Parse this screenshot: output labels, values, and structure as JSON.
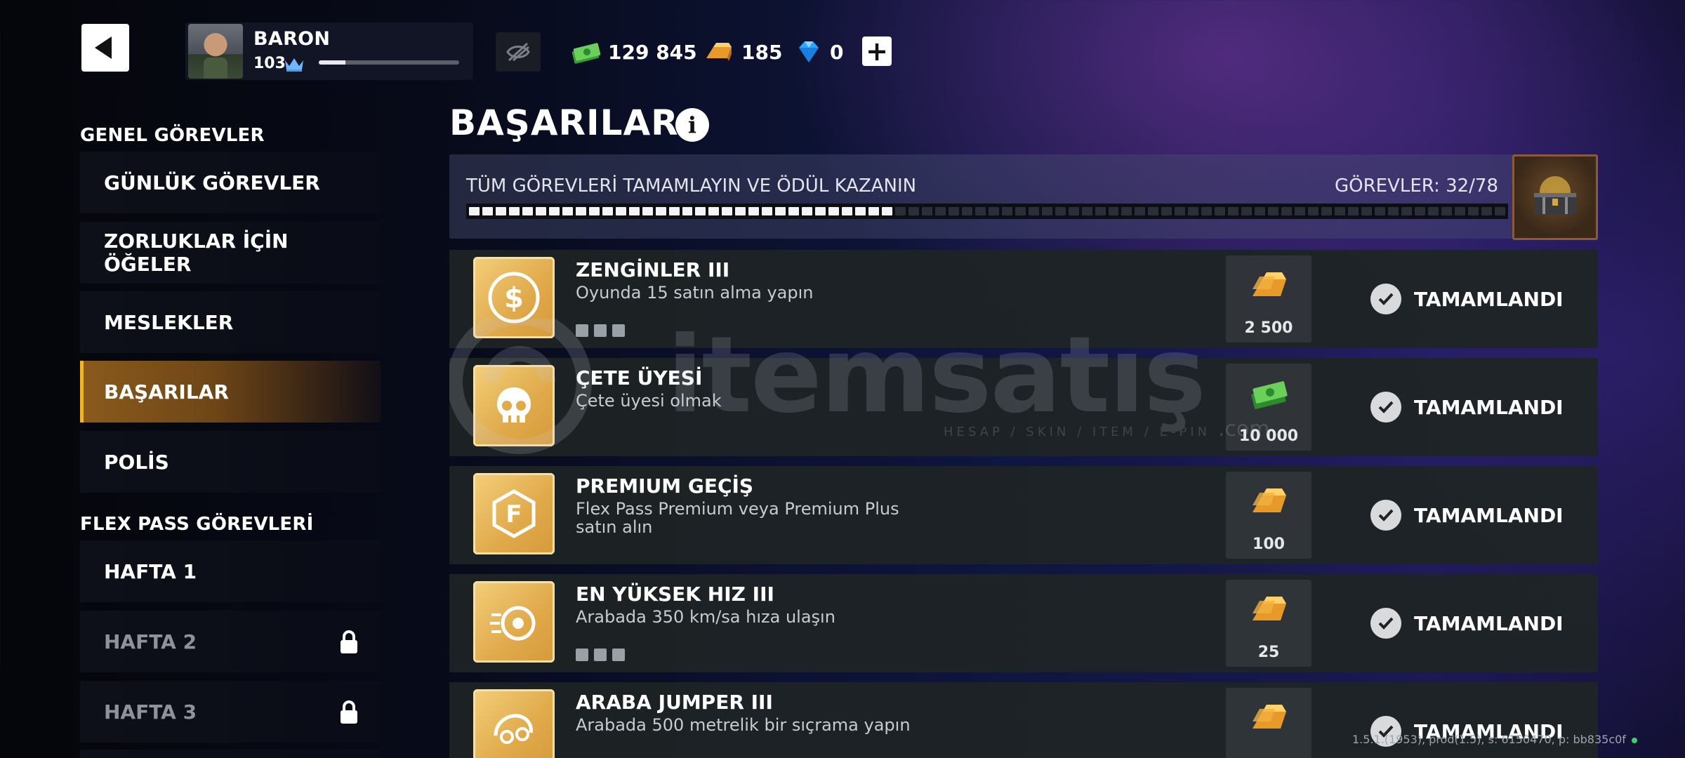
{
  "player": {
    "name": "BARON",
    "level": "103",
    "xp_fraction": 0.19
  },
  "currencies": {
    "cash": "129 845",
    "gold": "185",
    "gems": "0",
    "plus_label": "+"
  },
  "sidebar": {
    "section1": "GENEL GÖREVLER",
    "items1": [
      {
        "label": "GÜNLÜK GÖREVLER"
      },
      {
        "label": "ZORLUKLAR İÇİN ÖĞELER"
      },
      {
        "label": "MESLEKLER"
      },
      {
        "label": "BAŞARILAR"
      },
      {
        "label": "POLİS"
      }
    ],
    "section2": "FLEX PASS GÖREVLERİ",
    "items2": [
      {
        "label": "HAFTA 1"
      },
      {
        "label": "HAFTA 2"
      },
      {
        "label": "HAFTA 3"
      }
    ]
  },
  "main": {
    "title": "BAŞARILAR",
    "info_glyph": "i",
    "progress_title": "TÜM GÖREVLERİ TAMAMLAYIN VE ÖDÜL KAZANIN",
    "progress_count": "GÖREVLER: 32/78",
    "completed": 32,
    "total": 78
  },
  "achievements": [
    {
      "name": "ZENGİNLER III",
      "desc": "Oyunda 15 satın alma yapın",
      "reward": "2 500",
      "reward_type": "gold",
      "status": "TAMAMLANDI",
      "icon": "dollar-coin-icon"
    },
    {
      "name": "ÇETE ÜYESİ",
      "desc": "Çete üyesi olmak",
      "reward": "10 000",
      "reward_type": "cash",
      "status": "TAMAMLANDI",
      "icon": "skull-icon"
    },
    {
      "name": "PREMIUM GEÇİŞ",
      "desc": "Flex Pass Premium veya Premium Plus satın alın",
      "reward": "100",
      "reward_type": "gold",
      "status": "TAMAMLANDI",
      "icon": "flex-pass-icon"
    },
    {
      "name": "EN YÜKSEK HIZ III",
      "desc": "Arabada 350 km/sa hıza ulaşın",
      "reward": "25",
      "reward_type": "gold",
      "status": "TAMAMLANDI",
      "icon": "speed-wheel-icon"
    },
    {
      "name": "ARABA JUMPER III",
      "desc": "Arabada 500 metrelik bir sıçrama yapın",
      "reward": "",
      "reward_type": "gold",
      "status": "TAMAMLANDI",
      "icon": "car-jump-icon"
    }
  ],
  "watermark": {
    "text": "itemsatış",
    "sub": "HESAP / SKIN / ITEM / E-PIN",
    "com": ".com"
  },
  "version": "1.5.1.(1953), prod(1.5), s: 6150470, p: bb835c0f"
}
